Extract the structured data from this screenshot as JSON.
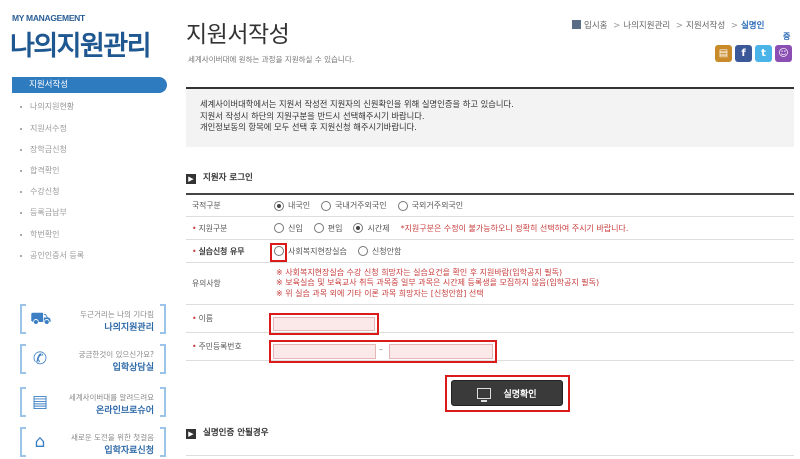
{
  "brand": {
    "subtitle": "MY MANAGEMENT",
    "title": "나의지원관리"
  },
  "sidebar": {
    "active": "지원서작성",
    "items": [
      "나의지원현황",
      "지원서수정",
      "장학금신청",
      "합격확인",
      "수강신청",
      "등록금납부",
      "학번확인",
      "공인인증서 등록"
    ],
    "boxes": [
      {
        "small": "두근거리는 나의 기다림",
        "big": "나의지원관리",
        "icon": "person-desk-icon"
      },
      {
        "small": "궁금한것이 있으신가요?",
        "big": "입학상담실",
        "icon": "phone-icon"
      },
      {
        "small": "세계사이버대를 알려드려요",
        "big": "온라인브로슈어",
        "icon": "brochure-icon"
      },
      {
        "small": "새로운 도전을 위한 첫걸음",
        "big": "입학자료신청",
        "icon": "shirt-icon"
      }
    ]
  },
  "header": {
    "title": "지원서작성",
    "subtitle": "세계사이버대에 원하는 과정을 지원하실 수 있습니다.",
    "breadcrumb": {
      "home": "입시홈",
      "level1": "나의지원관리",
      "level2": "지원서작성",
      "current": "실명인",
      "current_tail": "증"
    }
  },
  "share": {
    "icons": [
      "print-icon",
      "facebook-icon",
      "twitter-icon",
      "me2day-icon"
    ],
    "colors": [
      "#c98a2a",
      "#3b5998",
      "#4ab3e8",
      "#8b4fb3"
    ]
  },
  "notice": {
    "lines": [
      "세계사이버대학에서는 지원서 작성전 지원자의 신원확인을 위해 실명인증을 하고 있습니다.",
      "지원서 작성시 하단의 지원구분을 반드시 선택해주시기 바랍니다.",
      "개인정보동의 항목에 모두 선택 후 지원신청 해주시기바랍니다."
    ]
  },
  "login_section": {
    "title": "지원자 로그인"
  },
  "form": {
    "nationality": {
      "label": "국적구분",
      "options": [
        "내국인",
        "국내거주외국인",
        "국외거주외국인"
      ],
      "selected": 0
    },
    "apply_type": {
      "label": "지원구분",
      "options": [
        "신입",
        "편입",
        "시간제"
      ],
      "selected": 2,
      "note": "*지원구분은 수정이 불가능하오니 정확히 선택하여 주시기 바랍니다."
    },
    "practice": {
      "label": "실습신청 유무",
      "options": [
        "사회복지현장실습",
        "신청안함"
      ]
    },
    "notes": {
      "label": "유의사항",
      "lines": [
        "※ 사회복지현장실습 수강 신청 희망자는 실습요건을 확인 후 지원바람(입학공지 필독)",
        "※ 보육실습 및 보육교사 취득 과목중 일부 과목은 시간제 등록생을 모집하지 않음(입학공지 필독)",
        "※ 위 실습 과목 외에 기타 이론 과목 희망자는 [신청안함] 선택"
      ]
    },
    "name": {
      "label": "이름",
      "value": ""
    },
    "resident_no": {
      "label": "주민등록번호",
      "separator": "–",
      "first": "",
      "second": ""
    }
  },
  "confirm_button": {
    "label": "실명확인"
  },
  "fail_section": {
    "title": "실명인증 안될경우"
  }
}
